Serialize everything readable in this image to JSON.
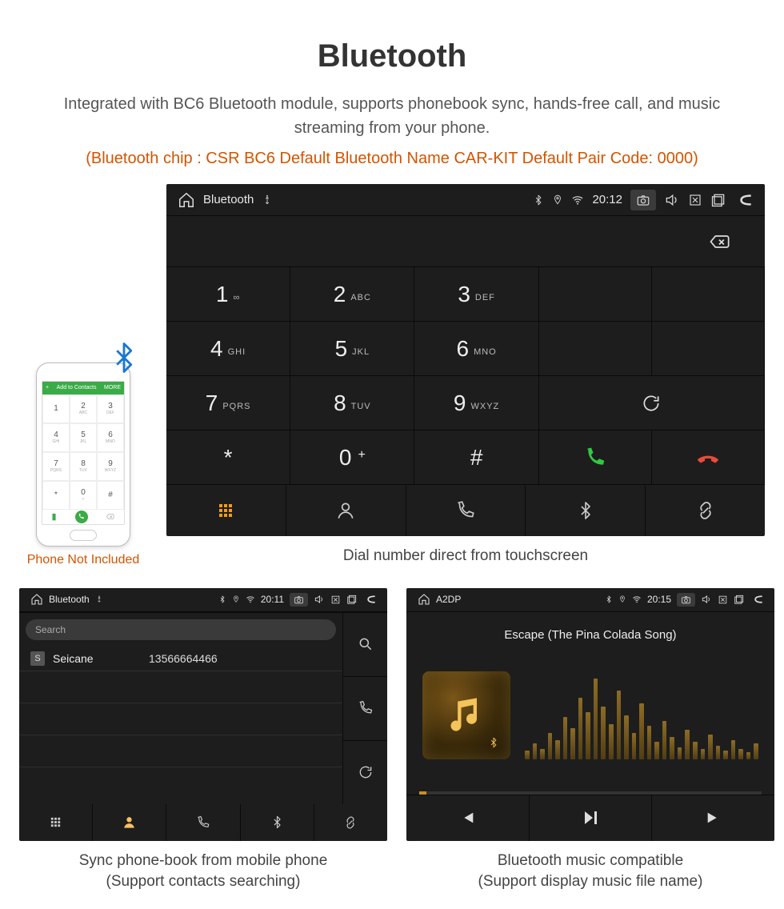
{
  "header": {
    "title": "Bluetooth",
    "subtitle": "Integrated with BC6 Bluetooth module, supports phonebook sync, hands-free call, and music streaming from your phone.",
    "specs": "(Bluetooth chip : CSR BC6    Default Bluetooth Name CAR-KIT    Default Pair Code: 0000)"
  },
  "phone": {
    "caption": "Phone Not Included",
    "header_left": "+",
    "header_text": "Add to Contacts",
    "header_more": "MORE",
    "keys": [
      {
        "d": "1",
        "s": ""
      },
      {
        "d": "2",
        "s": "ABC"
      },
      {
        "d": "3",
        "s": "DEF"
      },
      {
        "d": "4",
        "s": "GHI"
      },
      {
        "d": "5",
        "s": "JKL"
      },
      {
        "d": "6",
        "s": "MNO"
      },
      {
        "d": "7",
        "s": "PQRS"
      },
      {
        "d": "8",
        "s": "TUV"
      },
      {
        "d": "9",
        "s": "WXYZ"
      },
      {
        "d": "*",
        "s": ""
      },
      {
        "d": "0",
        "s": "+"
      },
      {
        "d": "#",
        "s": ""
      }
    ]
  },
  "dialer": {
    "status_title": "Bluetooth",
    "time": "20:12",
    "keys": [
      {
        "d": "1",
        "s": "∞"
      },
      {
        "d": "2",
        "s": "ABC"
      },
      {
        "d": "3",
        "s": "DEF"
      },
      {
        "d": "4",
        "s": "GHI"
      },
      {
        "d": "5",
        "s": "JKL"
      },
      {
        "d": "6",
        "s": "MNO"
      },
      {
        "d": "7",
        "s": "PQRS"
      },
      {
        "d": "8",
        "s": "TUV"
      },
      {
        "d": "9",
        "s": "WXYZ"
      },
      {
        "d": "*",
        "s": ""
      },
      {
        "d": "0",
        "s": "+",
        "plus": true
      },
      {
        "d": "#",
        "s": ""
      }
    ],
    "caption": "Dial number direct from touchscreen"
  },
  "contacts": {
    "status_title": "Bluetooth",
    "time": "20:11",
    "search_placeholder": "Search",
    "rows": [
      {
        "badge": "S",
        "name": "Seicane",
        "number": "13566664466"
      }
    ],
    "caption_line1": "Sync phone-book from mobile phone",
    "caption_line2": "(Support contacts searching)"
  },
  "music": {
    "status_title": "A2DP",
    "time": "20:15",
    "track": "Escape (The Pina Colada Song)",
    "caption_line1": "Bluetooth music compatible",
    "caption_line2": "(Support display music file name)",
    "bars": [
      10,
      18,
      12,
      30,
      22,
      48,
      36,
      70,
      54,
      92,
      60,
      40,
      78,
      50,
      30,
      64,
      38,
      20,
      44,
      26,
      14,
      34,
      20,
      12,
      28,
      16,
      10,
      22,
      12,
      8,
      18
    ]
  }
}
